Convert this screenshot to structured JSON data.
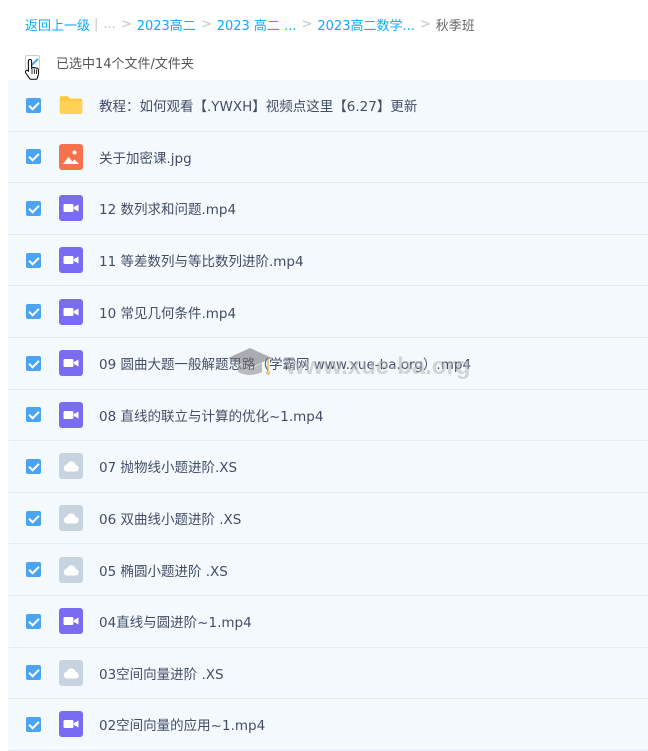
{
  "breadcrumb": {
    "back": "返回上一级",
    "divider": "|",
    "ellipsis": "...",
    "sep": ">",
    "items": [
      "2023高二",
      "2023 高二 ...",
      "2023高二数学..."
    ],
    "current": "秋季班"
  },
  "selection": {
    "text": "已选中14个文件/文件夹"
  },
  "files": [
    {
      "name": "教程：如何观看【.YWXH】视频点这里【6.27】更新",
      "type": "folder",
      "checked": true
    },
    {
      "name": "关于加密课.jpg",
      "type": "image",
      "checked": true
    },
    {
      "name": "12 数列求和问题.mp4",
      "type": "video",
      "checked": true
    },
    {
      "name": "11 等差数列与等比数列进阶.mp4",
      "type": "video",
      "checked": true
    },
    {
      "name": "10 常见几何条件.mp4",
      "type": "video",
      "checked": true
    },
    {
      "name": "09 圆曲大题一般解题思路（学霸网 www.xue-ba.org）.mp4",
      "type": "video",
      "checked": true
    },
    {
      "name": "08 直线的联立与计算的优化~1.mp4",
      "type": "video",
      "checked": true
    },
    {
      "name": "07 抛物线小题进阶.XS",
      "type": "cloud",
      "checked": true
    },
    {
      "name": "06 双曲线小题进阶 .XS",
      "type": "cloud",
      "checked": true
    },
    {
      "name": "05 椭圆小题进阶 .XS",
      "type": "cloud",
      "checked": true
    },
    {
      "name": "04直线与圆进阶~1.mp4",
      "type": "video",
      "checked": true
    },
    {
      "name": "03空间向量进阶 .XS",
      "type": "cloud",
      "checked": true
    },
    {
      "name": "02空间向量的应用~1.mp4",
      "type": "video",
      "checked": true
    }
  ],
  "watermark": {
    "text": "www.xue-ba.org"
  },
  "colors": {
    "link": "#09aaff",
    "checkbox": "#4ba4f2",
    "folder": "#ffc83d",
    "image": "#f5734c",
    "video": "#7a6cf0",
    "cloud": "#c7d3de",
    "list_bg": "#f4f9fe"
  }
}
